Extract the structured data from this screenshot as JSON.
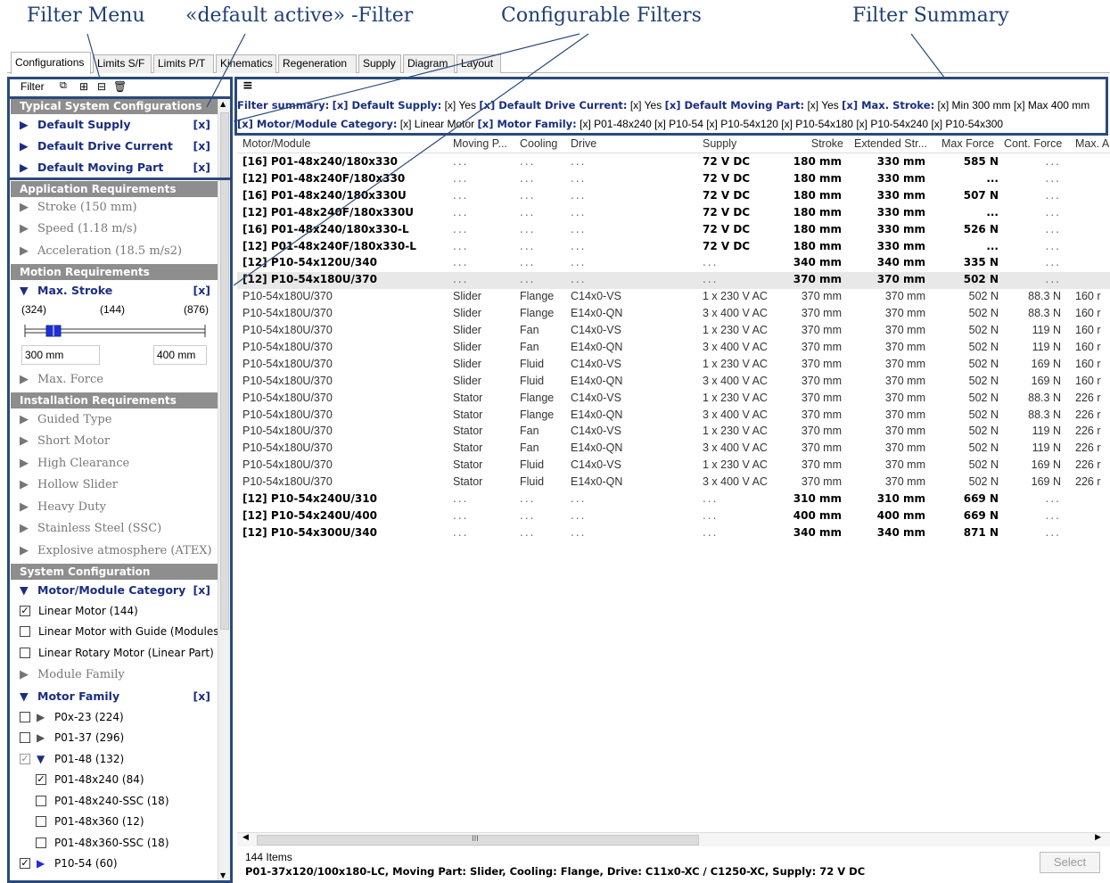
{
  "annotations": [
    "Filter Menu",
    "«default active» -Filter",
    "Configurable Filters",
    "Filter Summary"
  ],
  "tabs": [
    "Configurations",
    "Limits S/F",
    "Limits P/T",
    "Kinematics",
    "Regeneration",
    "Supply",
    "Diagram",
    "Layout"
  ],
  "filter_menu": {
    "label": "Filter",
    "icons": [
      "add-filter-icon",
      "expand-all-icon",
      "collapse-all-icon",
      "delete-icon"
    ]
  },
  "grid_menu_icon": "≡",
  "sidebar": {
    "sec_typical": "Typical System Configurations",
    "default_supply": "Default Supply",
    "default_drive_current": "Default Drive Current",
    "default_moving_part": "Default Moving Part",
    "x": "[x]",
    "sec_application": "Application Requirements",
    "stroke": "Stroke (150 mm)",
    "speed": "Speed (1.18 m/s)",
    "acceleration": "Acceleration (18.5 m/s2)",
    "sec_motion": "Motion Requirements",
    "max_stroke": "Max. Stroke",
    "range_min": "(324)",
    "range_mid": "(144)",
    "range_max": "(876)",
    "input_min": "300 mm",
    "input_max": "400 mm",
    "max_force": "Max. Force",
    "sec_installation": "Installation Requirements",
    "guided_type": "Guided Type",
    "short_motor": "Short Motor",
    "high_clearance": "High Clearance",
    "hollow_slider": "Hollow Slider",
    "heavy_duty": "Heavy Duty",
    "stainless": "Stainless Steel (SSC)",
    "atex": "Explosive atmosphere (ATEX)",
    "sec_system": "System Configuration",
    "motor_module_category": "Motor/Module Category",
    "cat_linear_motor": "Linear Motor (144)",
    "cat_with_guide": "Linear Motor with Guide (Modules) (",
    "cat_rotary": "Linear Rotary Motor (Linear Part) (12",
    "module_family": "Module Family",
    "motor_family": "Motor Family",
    "fam_p0x23": "P0x-23 (224)",
    "fam_p0137": "P01-37 (296)",
    "fam_p0148": "P01-48 (132)",
    "fam_p0148x240": "P01-48x240 (84)",
    "fam_p0148x240ssc": "P01-48x240-SSC (18)",
    "fam_p0148x360": "P01-48x360 (12)",
    "fam_p0148x360ssc": "P01-48x360-SSC (18)",
    "fam_p1054": "P10-54 (60)"
  },
  "summary": {
    "prefix": "Filter summary:",
    "line1": [
      {
        "key": "[x] Default Supply:",
        "val": "[x] Yes"
      },
      {
        "key": "[x] Default Drive Current:",
        "val": "[x] Yes"
      },
      {
        "key": "[x] Default Moving Part:",
        "val": "[x] Yes"
      },
      {
        "key": "[x] Max. Stroke:",
        "val": "[x] Min 300 mm  [x] Max 400 mm"
      }
    ],
    "line2": [
      {
        "key": "[x] Motor/Module Category:",
        "val": "[x] Linear Motor"
      },
      {
        "key": "[x] Motor Family:",
        "val": "[x] P01-48x240  [x] P10-54  [x] P10-54x120  [x] P10-54x180  [x] P10-54x240  [x] P10-54x300"
      }
    ]
  },
  "columns": [
    "Motor/Module",
    "Moving P...",
    "Cooling",
    "Drive",
    "Supply",
    "Stroke",
    "Extended Str...",
    "Max Force",
    "Cont. Force",
    "Max. A"
  ],
  "rows": [
    {
      "g": true,
      "c": [
        "[16] P01-48x240/180x330",
        "...",
        "...",
        "...",
        "72 V DC",
        "180 mm",
        "330 mm",
        "585 N",
        "...",
        ""
      ]
    },
    {
      "g": true,
      "c": [
        "[12] P01-48x240F/180x330",
        "...",
        "...",
        "...",
        "72 V DC",
        "180 mm",
        "330 mm",
        "...",
        "...",
        ""
      ]
    },
    {
      "g": true,
      "c": [
        "[16] P01-48x240/180x330U",
        "...",
        "...",
        "...",
        "72 V DC",
        "180 mm",
        "330 mm",
        "507 N",
        "...",
        ""
      ]
    },
    {
      "g": true,
      "c": [
        "[12] P01-48x240F/180x330U",
        "...",
        "...",
        "...",
        "72 V DC",
        "180 mm",
        "330 mm",
        "...",
        "...",
        ""
      ]
    },
    {
      "g": true,
      "c": [
        "[16] P01-48x240/180x330-L",
        "...",
        "...",
        "...",
        "72 V DC",
        "180 mm",
        "330 mm",
        "526 N",
        "...",
        ""
      ]
    },
    {
      "g": true,
      "c": [
        "[12] P01-48x240F/180x330-L",
        "...",
        "...",
        "...",
        "72 V DC",
        "180 mm",
        "330 mm",
        "...",
        "...",
        ""
      ]
    },
    {
      "g": true,
      "c": [
        "[12] P10-54x120U/340",
        "...",
        "...",
        "...",
        "...",
        "340 mm",
        "340 mm",
        "335 N",
        "...",
        ""
      ]
    },
    {
      "g": true,
      "s": true,
      "c": [
        "[12] P10-54x180U/370",
        "...",
        "...",
        "...",
        "...",
        "370 mm",
        "370 mm",
        "502 N",
        "...",
        ""
      ]
    },
    {
      "c": [
        "P10-54x180U/370",
        "Slider",
        "Flange",
        "C14x0-VS",
        "1 x 230 V AC",
        "370 mm",
        "370 mm",
        "502 N",
        "88.3 N",
        "160 r"
      ]
    },
    {
      "c": [
        "P10-54x180U/370",
        "Slider",
        "Flange",
        "E14x0-QN",
        "3 x 400 V AC",
        "370 mm",
        "370 mm",
        "502 N",
        "88.3 N",
        "160 r"
      ]
    },
    {
      "c": [
        "P10-54x180U/370",
        "Slider",
        "Fan",
        "C14x0-VS",
        "1 x 230 V AC",
        "370 mm",
        "370 mm",
        "502 N",
        "119 N",
        "160 r"
      ]
    },
    {
      "c": [
        "P10-54x180U/370",
        "Slider",
        "Fan",
        "E14x0-QN",
        "3 x 400 V AC",
        "370 mm",
        "370 mm",
        "502 N",
        "119 N",
        "160 r"
      ]
    },
    {
      "c": [
        "P10-54x180U/370",
        "Slider",
        "Fluid",
        "C14x0-VS",
        "1 x 230 V AC",
        "370 mm",
        "370 mm",
        "502 N",
        "169 N",
        "160 r"
      ]
    },
    {
      "c": [
        "P10-54x180U/370",
        "Slider",
        "Fluid",
        "E14x0-QN",
        "3 x 400 V AC",
        "370 mm",
        "370 mm",
        "502 N",
        "169 N",
        "160 r"
      ]
    },
    {
      "c": [
        "P10-54x180U/370",
        "Stator",
        "Flange",
        "C14x0-VS",
        "1 x 230 V AC",
        "370 mm",
        "370 mm",
        "502 N",
        "88.3 N",
        "226 r"
      ]
    },
    {
      "c": [
        "P10-54x180U/370",
        "Stator",
        "Flange",
        "E14x0-QN",
        "3 x 400 V AC",
        "370 mm",
        "370 mm",
        "502 N",
        "88.3 N",
        "226 r"
      ]
    },
    {
      "c": [
        "P10-54x180U/370",
        "Stator",
        "Fan",
        "C14x0-VS",
        "1 x 230 V AC",
        "370 mm",
        "370 mm",
        "502 N",
        "119 N",
        "226 r"
      ]
    },
    {
      "c": [
        "P10-54x180U/370",
        "Stator",
        "Fan",
        "E14x0-QN",
        "3 x 400 V AC",
        "370 mm",
        "370 mm",
        "502 N",
        "119 N",
        "226 r"
      ]
    },
    {
      "c": [
        "P10-54x180U/370",
        "Stator",
        "Fluid",
        "C14x0-VS",
        "1 x 230 V AC",
        "370 mm",
        "370 mm",
        "502 N",
        "169 N",
        "226 r"
      ]
    },
    {
      "c": [
        "P10-54x180U/370",
        "Stator",
        "Fluid",
        "E14x0-QN",
        "3 x 400 V AC",
        "370 mm",
        "370 mm",
        "502 N",
        "169 N",
        "226 r"
      ]
    },
    {
      "g": true,
      "c": [
        "[12] P10-54x240U/310",
        "...",
        "...",
        "...",
        "...",
        "310 mm",
        "310 mm",
        "669 N",
        "...",
        ""
      ]
    },
    {
      "g": true,
      "c": [
        "[12] P10-54x240U/400",
        "...",
        "...",
        "...",
        "...",
        "400 mm",
        "400 mm",
        "669 N",
        "...",
        ""
      ]
    },
    {
      "g": true,
      "c": [
        "[12] P10-54x300U/340",
        "...",
        "...",
        "...",
        "...",
        "340 mm",
        "340 mm",
        "871 N",
        "...",
        ""
      ]
    }
  ],
  "hscroll_grip": "III",
  "status": {
    "count": "144 Items",
    "detail": "P01-37x120/100x180-LC, Moving Part: Slider, Cooling: Flange, Drive: C11x0-XC / C1250-XC, Supply: 72 V DC",
    "select": "Select"
  },
  "colors": {
    "frame": "#2a4a7a",
    "annotation": "#1f3f73",
    "filter_blue": "#1a2e80",
    "section_grey": "#8e8e8e"
  }
}
